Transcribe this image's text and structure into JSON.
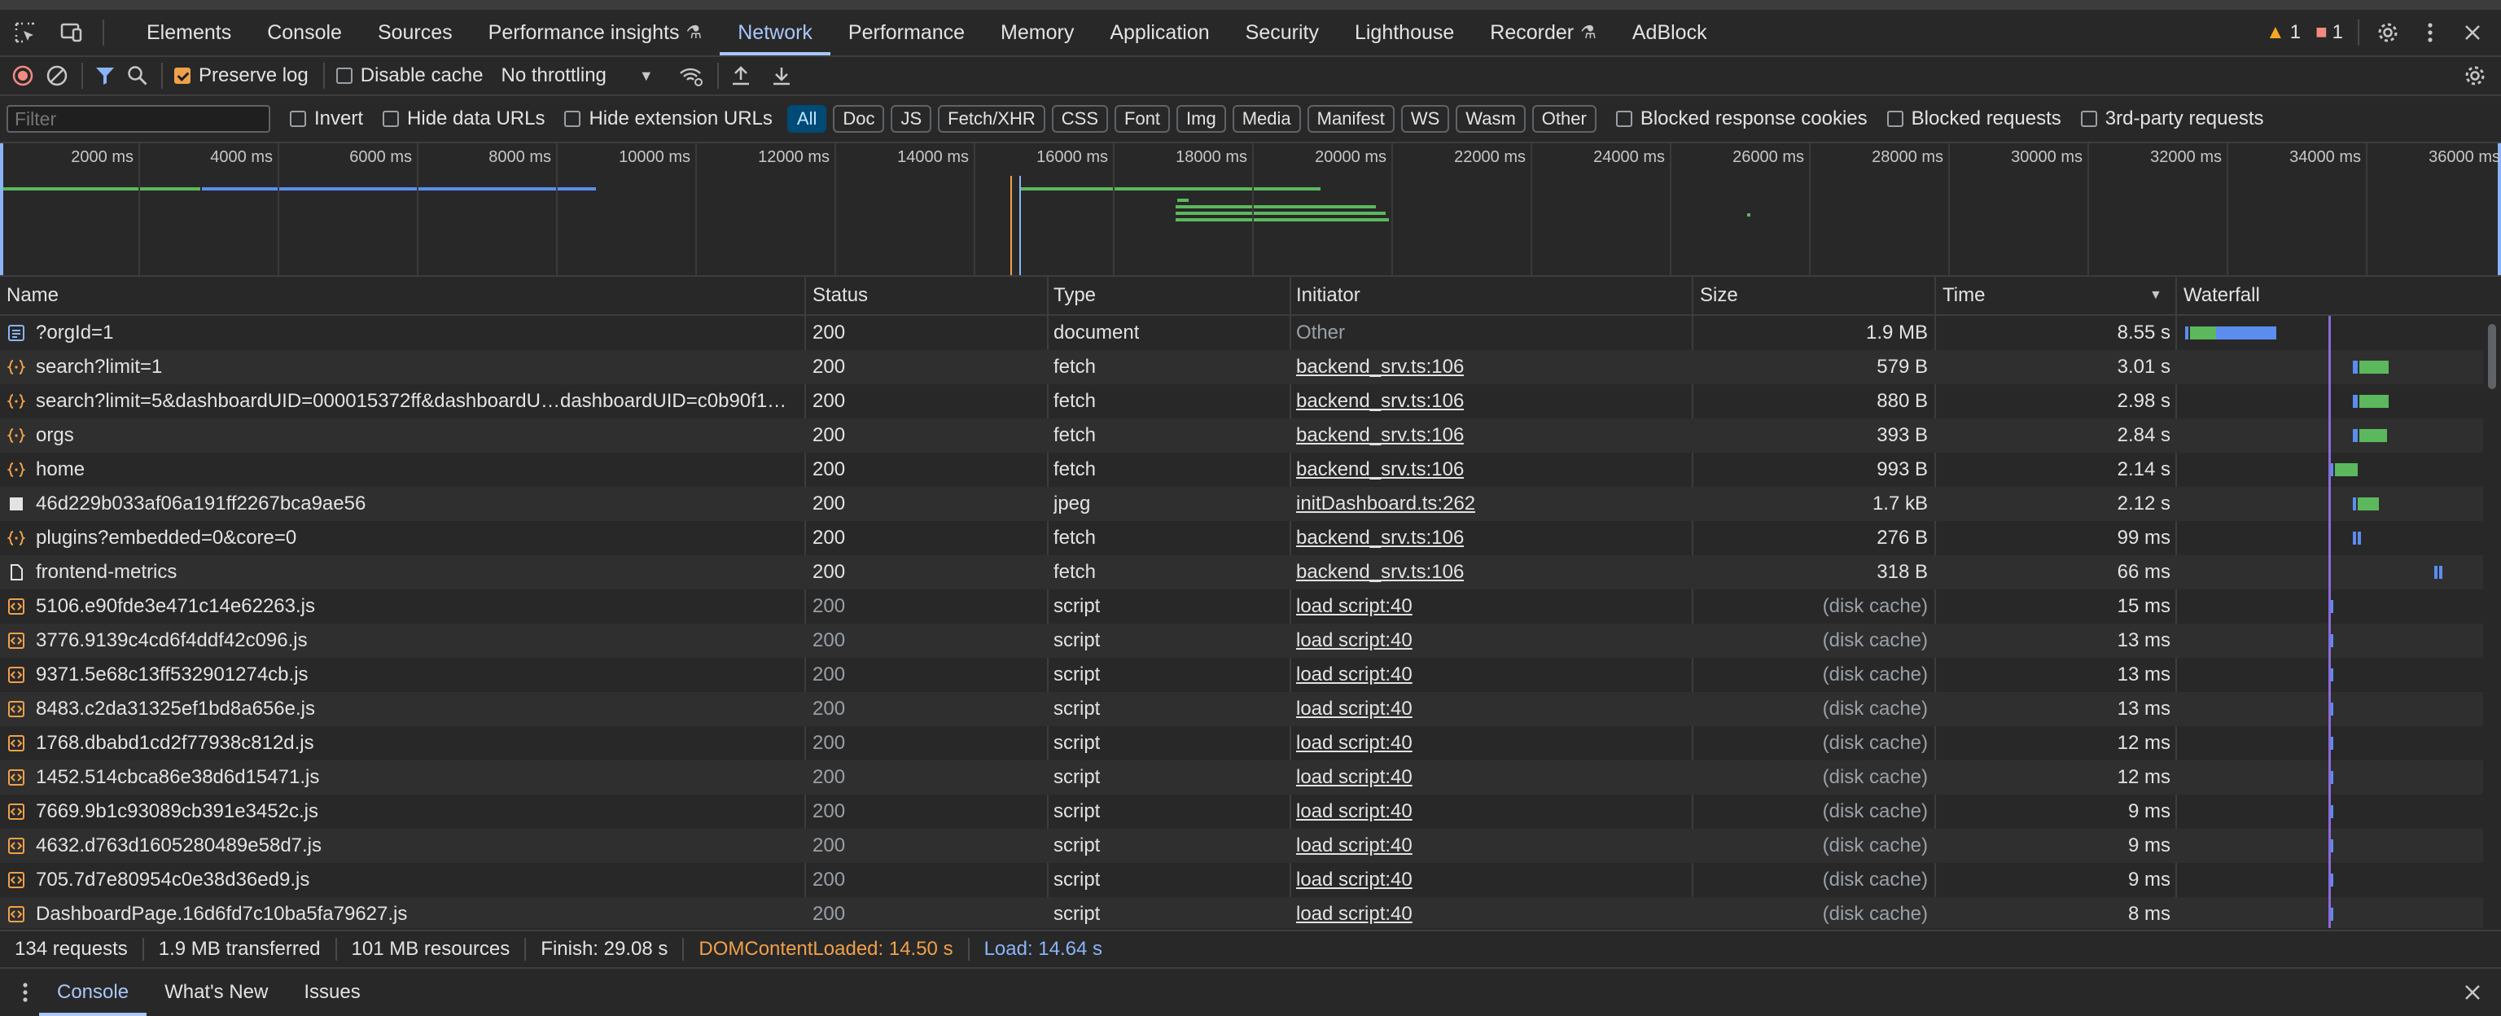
{
  "tabbar": {
    "tabs": [
      {
        "label": "Elements"
      },
      {
        "label": "Console"
      },
      {
        "label": "Sources"
      },
      {
        "label": "Performance insights",
        "experimental": true
      },
      {
        "label": "Network",
        "active": true
      },
      {
        "label": "Performance"
      },
      {
        "label": "Memory"
      },
      {
        "label": "Application"
      },
      {
        "label": "Security"
      },
      {
        "label": "Lighthouse"
      },
      {
        "label": "Recorder",
        "experimental": true
      },
      {
        "label": "AdBlock"
      }
    ],
    "warnings_count": "1",
    "issues_count": "1"
  },
  "toolbar": {
    "preserve_log_label": "Preserve log",
    "preserve_log_checked": true,
    "disable_cache_label": "Disable cache",
    "throttling_value": "No throttling"
  },
  "filterbar": {
    "filter_placeholder": "Filter",
    "invert_label": "Invert",
    "hide_data_urls_label": "Hide data URLs",
    "hide_extension_urls_label": "Hide extension URLs",
    "type_chips": [
      "All",
      "Doc",
      "JS",
      "Fetch/XHR",
      "CSS",
      "Font",
      "Img",
      "Media",
      "Manifest",
      "WS",
      "Wasm",
      "Other"
    ],
    "active_chip": "All",
    "blocked_cookies_label": "Blocked response cookies",
    "blocked_requests_label": "Blocked requests",
    "third_party_label": "3rd-party requests"
  },
  "overview": {
    "ticks": [
      "2000 ms",
      "4000 ms",
      "6000 ms",
      "8000 ms",
      "10000 ms",
      "12000 ms",
      "14000 ms",
      "16000 ms",
      "18000 ms",
      "20000 ms",
      "22000 ms",
      "24000 ms",
      "26000 ms",
      "28000 ms",
      "30000 ms",
      "32000 ms",
      "34000 ms",
      "36000 ms"
    ]
  },
  "table": {
    "headers": {
      "name": "Name",
      "status": "Status",
      "type": "Type",
      "initiator": "Initiator",
      "size": "Size",
      "time": "Time",
      "waterfall": "Waterfall"
    },
    "rows": [
      {
        "name": "?orgId=1",
        "icon": "document",
        "status": "200",
        "type": "document",
        "initiator": "Other",
        "size": "1.9 MB",
        "time": "8.55 s"
      },
      {
        "name": "search?limit=1",
        "icon": "fetch",
        "status": "200",
        "type": "fetch",
        "initiator": "backend_srv.ts:106",
        "size": "579 B",
        "time": "3.01 s"
      },
      {
        "name": "search?limit=5&dashboardUID=000015372ff&dashboardU…dashboardUID=c0b90f1…",
        "icon": "fetch",
        "status": "200",
        "type": "fetch",
        "initiator": "backend_srv.ts:106",
        "size": "880 B",
        "time": "2.98 s"
      },
      {
        "name": "orgs",
        "icon": "fetch",
        "status": "200",
        "type": "fetch",
        "initiator": "backend_srv.ts:106",
        "size": "393 B",
        "time": "2.84 s"
      },
      {
        "name": "home",
        "icon": "fetch",
        "status": "200",
        "type": "fetch",
        "initiator": "backend_srv.ts:106",
        "size": "993 B",
        "time": "2.14 s"
      },
      {
        "name": "46d229b033af06a191ff2267bca9ae56",
        "icon": "image",
        "status": "200",
        "type": "jpeg",
        "initiator": "initDashboard.ts:262",
        "size": "1.7 kB",
        "time": "2.12 s"
      },
      {
        "name": "plugins?embedded=0&core=0",
        "icon": "fetch",
        "status": "200",
        "type": "fetch",
        "initiator": "backend_srv.ts:106",
        "size": "276 B",
        "time": "99 ms"
      },
      {
        "name": "frontend-metrics",
        "icon": "file",
        "status": "200",
        "type": "fetch",
        "initiator": "backend_srv.ts:106",
        "size": "318 B",
        "time": "66 ms"
      },
      {
        "name": "5106.e90fde3e471c14e62263.js",
        "icon": "script",
        "status": "200",
        "type": "script",
        "initiator": "load script:40",
        "size": "(disk cache)",
        "time": "15 ms"
      },
      {
        "name": "3776.9139c4cd6f4ddf42c096.js",
        "icon": "script",
        "status": "200",
        "type": "script",
        "initiator": "load script:40",
        "size": "(disk cache)",
        "time": "13 ms"
      },
      {
        "name": "9371.5e68c13ff532901274cb.js",
        "icon": "script",
        "status": "200",
        "type": "script",
        "initiator": "load script:40",
        "size": "(disk cache)",
        "time": "13 ms"
      },
      {
        "name": "8483.c2da31325ef1bd8a656e.js",
        "icon": "script",
        "status": "200",
        "type": "script",
        "initiator": "load script:40",
        "size": "(disk cache)",
        "time": "13 ms"
      },
      {
        "name": "1768.dbabd1cd2f77938c812d.js",
        "icon": "script",
        "status": "200",
        "type": "script",
        "initiator": "load script:40",
        "size": "(disk cache)",
        "time": "12 ms"
      },
      {
        "name": "1452.514cbca86e38d6d15471.js",
        "icon": "script",
        "status": "200",
        "type": "script",
        "initiator": "load script:40",
        "size": "(disk cache)",
        "time": "12 ms"
      },
      {
        "name": "7669.9b1c93089cb391e3452c.js",
        "icon": "script",
        "status": "200",
        "type": "script",
        "initiator": "load script:40",
        "size": "(disk cache)",
        "time": "9 ms"
      },
      {
        "name": "4632.d763d1605280489e58d7.js",
        "icon": "script",
        "status": "200",
        "type": "script",
        "initiator": "load script:40",
        "size": "(disk cache)",
        "time": "9 ms"
      },
      {
        "name": "705.7d7e80954c0e38d36ed9.js",
        "icon": "script",
        "status": "200",
        "type": "script",
        "initiator": "load script:40",
        "size": "(disk cache)",
        "time": "9 ms"
      },
      {
        "name": "DashboardPage.16d6fd7c10ba5fa79627.js",
        "icon": "script",
        "status": "200",
        "type": "script",
        "initiator": "load script:40",
        "size": "(disk cache)",
        "time": "8 ms"
      }
    ]
  },
  "statusbar": {
    "requests": "134 requests",
    "transferred": "1.9 MB transferred",
    "resources": "101 MB resources",
    "finish": "Finish: 29.08 s",
    "dom_content_loaded": "DOMContentLoaded: 14.50 s",
    "load": "Load: 14.64 s"
  },
  "drawer": {
    "tabs": [
      {
        "label": "Console",
        "active": true
      },
      {
        "label": "What's New"
      },
      {
        "label": "Issues"
      }
    ]
  },
  "colors": {
    "accent": "#a8c7fa",
    "waterfall_wait": "#5b8def",
    "waterfall_download": "#5cb85c",
    "dcl": "#f0a04b",
    "load": "#8ab4f8"
  }
}
